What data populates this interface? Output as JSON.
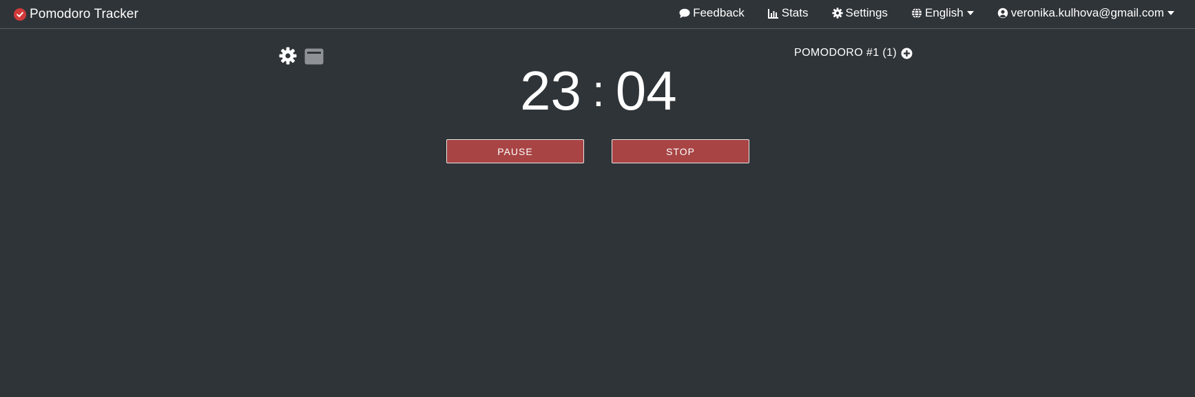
{
  "navbar": {
    "brand_label": "Pomodoro Tracker",
    "feedback_label": "Feedback",
    "stats_label": "Stats",
    "settings_label": "Settings",
    "language_label": "English",
    "user_email": "veronika.kulhova@gmail.com"
  },
  "timer": {
    "minutes": "23",
    "separator": ":",
    "seconds": "04",
    "session_label": "POMODORO #1 (1)"
  },
  "controls": {
    "pause_label": "PAUSE",
    "stop_label": "STOP"
  },
  "colors": {
    "background": "#2f3438",
    "button": "#a84444",
    "brand_icon": "#d23a3a",
    "text": "#ffffff"
  },
  "icons": {
    "brand": "check-circle-icon",
    "feedback": "comment-icon",
    "stats": "bar-chart-icon",
    "settings": "gear-icon",
    "language": "globe-icon",
    "user": "user-circle-icon",
    "timer_settings": "gear-icon",
    "window": "window-icon",
    "add": "plus-circle-icon"
  }
}
